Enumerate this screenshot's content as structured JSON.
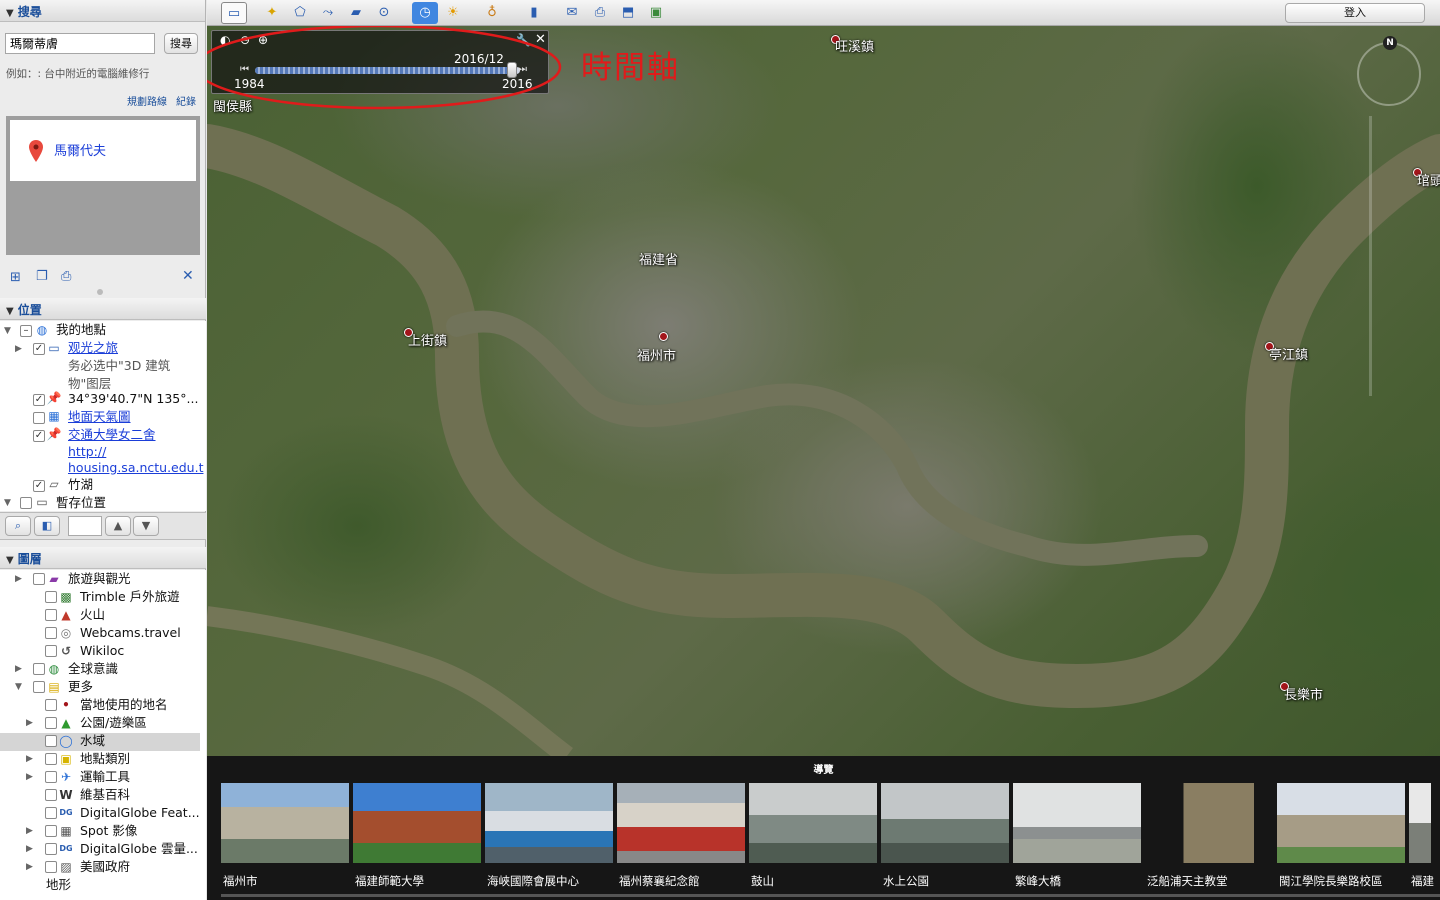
{
  "search": {
    "title": "搜尋",
    "query": "瑪爾蒂膚",
    "button": "搜尋",
    "example": "例如：: 台中附近的電腦維修行",
    "route_link": "規劃路線",
    "history_link": "紀錄",
    "result": "馬爾代夫"
  },
  "places": {
    "title": "位置",
    "items": [
      {
        "label": "我的地點"
      },
      {
        "label": "观光之旅",
        "sub1": "务必选中\"3D 建筑",
        "sub2": "物\"图层"
      },
      {
        "label": "34°39'40.7\"N 135°..."
      },
      {
        "label": "地面天氣圖"
      },
      {
        "label": "交通大學女二舍",
        "sub1": "http://",
        "sub2": "housing.sa.nctu.edu.t"
      },
      {
        "label": "竹湖"
      },
      {
        "label": "暫存位置"
      }
    ]
  },
  "layers": {
    "title": "圖層",
    "items": [
      "旅遊與觀光",
      "Trimble 戶外旅遊",
      "火山",
      "Webcams.travel",
      "Wikiloc",
      "全球意識",
      "更多",
      "當地使用的地名",
      "公園/遊樂區",
      "水域",
      "地點類別",
      "運輸工具",
      "維基百科",
      "DigitalGlobe Feat...",
      "Spot 影像",
      "DigitalGlobe 雲量...",
      "美國政府",
      "地形"
    ]
  },
  "toolbar": {
    "signin": "登入"
  },
  "timeslider": {
    "current": "2016/12",
    "start": "1984",
    "end": "2016",
    "position": 0.97
  },
  "annotation": "時間軸",
  "map_labels": {
    "yixi": "㕵溪鎮",
    "minhou": "閩侯縣",
    "langqi": "琯頭",
    "fujian": "福建省",
    "shangjie": "上街鎮",
    "fuzhou": "福州市",
    "tingjiang": "亭江鎮",
    "changle": "長樂市"
  },
  "tour": {
    "title": "導覽",
    "items": [
      "福州市",
      "福建師範大學",
      "海峽國際會展中心",
      "福州蔡襄紀念館",
      "鼓山",
      "水上公園",
      "繁峰大橋",
      "泛船浦天主教堂",
      "閩江學院長樂路校區",
      "福建"
    ]
  },
  "colors": {
    "accent": "#1a4e9a",
    "annotation_red": "#e01b1b",
    "link": "#1b3ed8"
  }
}
